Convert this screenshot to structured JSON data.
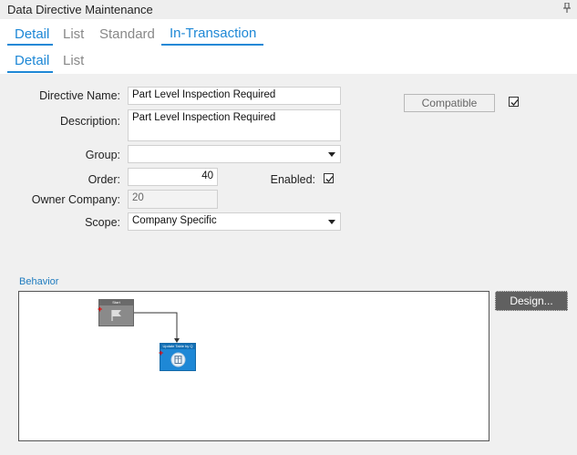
{
  "window": {
    "title": "Data Directive Maintenance"
  },
  "tabs_primary": [
    {
      "label": "Detail",
      "active": true
    },
    {
      "label": "List",
      "active": false
    },
    {
      "label": "Standard",
      "active": false
    },
    {
      "label": "In-Transaction",
      "active": true
    }
  ],
  "tabs_secondary": [
    {
      "label": "Detail",
      "active": true
    },
    {
      "label": "List",
      "active": false
    }
  ],
  "form": {
    "directive_name_label": "Directive Name:",
    "directive_name_value": "Part Level Inspection Required",
    "description_label": "Description:",
    "description_value": "Part Level Inspection Required",
    "group_label": "Group:",
    "group_value": "",
    "order_label": "Order:",
    "order_value": "40",
    "enabled_label": "Enabled:",
    "enabled_checked": true,
    "owner_company_label": "Owner Company:",
    "owner_company_value": "20",
    "scope_label": "Scope:",
    "scope_value": "Company Specific",
    "compatible_label": "Compatible",
    "compatible_checked": true
  },
  "behavior": {
    "section_label": "Behavior",
    "design_button": "Design...",
    "nodes": [
      {
        "title": "Start",
        "icon": "flag-icon"
      },
      {
        "title": "Update Table by Q",
        "icon": "table-update-icon"
      }
    ]
  },
  "colors": {
    "accent": "#1e88d6",
    "node_start": "#7a7a7a",
    "node_action": "#1e88d6"
  }
}
